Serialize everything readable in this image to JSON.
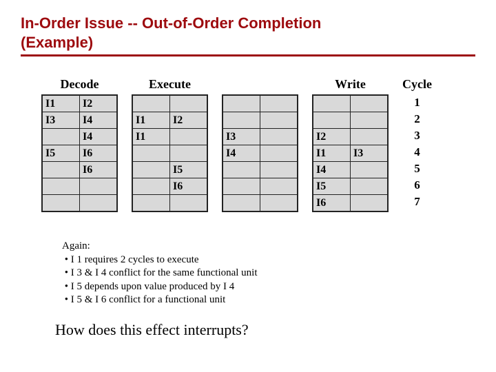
{
  "title_line1": "In-Order Issue -- Out-of-Order Completion",
  "title_line2": "(Example)",
  "stages": {
    "decode": {
      "label": "Decode",
      "rows": [
        [
          "I1",
          "I2"
        ],
        [
          "I3",
          "I4"
        ],
        [
          "",
          "I4"
        ],
        [
          "I5",
          "I6"
        ],
        [
          "",
          "I6"
        ],
        [
          "",
          ""
        ],
        [
          "",
          ""
        ]
      ]
    },
    "execute": {
      "label": "Execute",
      "rows": [
        [
          "",
          ""
        ],
        [
          "I1",
          "I2"
        ],
        [
          "I1",
          ""
        ],
        [
          "",
          ""
        ],
        [
          "",
          "I5"
        ],
        [
          "",
          "I6"
        ],
        [
          "",
          ""
        ]
      ]
    },
    "execute_col2": {
      "rows": [
        [
          "",
          ""
        ],
        [
          "",
          ""
        ],
        [
          "I3",
          ""
        ],
        [
          "I4",
          ""
        ],
        [
          "",
          ""
        ],
        [
          "",
          ""
        ],
        [
          "",
          ""
        ]
      ]
    },
    "write": {
      "label": "Write",
      "rows": [
        [
          "",
          ""
        ],
        [
          "",
          ""
        ],
        [
          "I2",
          ""
        ],
        [
          "I1",
          "I3"
        ],
        [
          "I4",
          ""
        ],
        [
          "I5",
          ""
        ],
        [
          "I6",
          ""
        ]
      ]
    },
    "cycle": {
      "label": "Cycle",
      "values": [
        "1",
        "2",
        "3",
        "4",
        "5",
        "6",
        "7"
      ]
    }
  },
  "notes": {
    "heading": "Again:",
    "lines": [
      "I 1 requires 2 cycles to execute",
      "I 3 & I 4 conflict for the same functional unit",
      "I 5 depends upon value produced by I 4",
      "I 5 & I 6 conflict for a functional unit"
    ]
  },
  "question": "How does this effect interrupts?"
}
